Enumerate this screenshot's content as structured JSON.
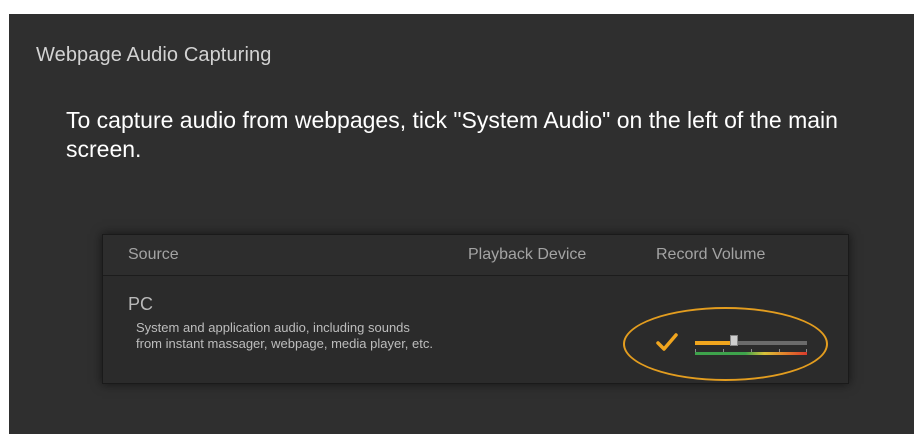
{
  "dialog": {
    "title": "Webpage Audio Capturing",
    "message": "To capture audio from webpages, tick \"System Audio\" on the left of the main screen."
  },
  "table": {
    "columns": [
      "Source",
      "Playback Device",
      "Record Volume"
    ],
    "row": {
      "name": "PC",
      "description_line1": "System and application audio, including sounds",
      "description_line2": "from instant massager, webpage, media player, etc.",
      "checked": true,
      "record_volume_fraction": 0.34
    }
  },
  "colors": {
    "accent": "#e39d1f",
    "background": "#2f2f2f",
    "panel": "#2b2b2b",
    "meter_green": "#3ea34c",
    "meter_red": "#d83a2c"
  },
  "icons": {
    "checkmark": "checkmark-icon"
  }
}
